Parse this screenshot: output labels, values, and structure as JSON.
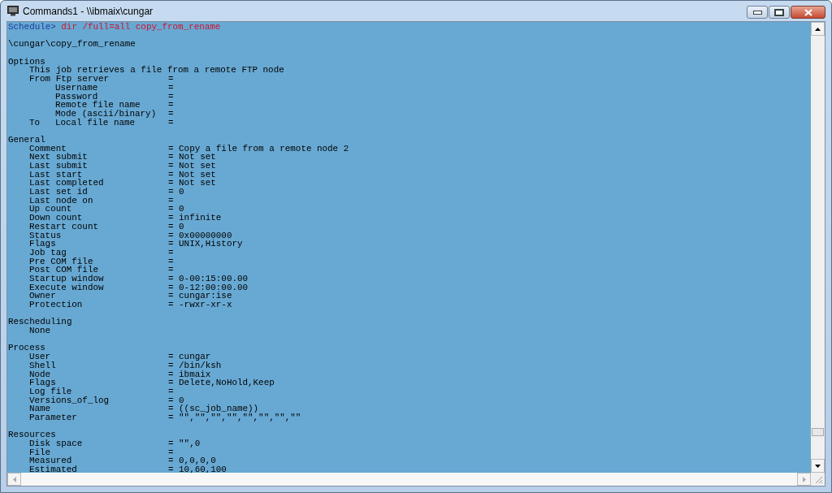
{
  "window": {
    "title": "Commands1 - \\\\ibmaix\\cungar"
  },
  "prompt": {
    "prefix": "Schedule>",
    "command": "dir /full=all copy_from_rename"
  },
  "path": "\\cungar\\copy_from_rename",
  "sections": [
    {
      "heading": "Options",
      "lines": [
        {
          "kind": "text",
          "label": "This job retrieves a file from a remote FTP node"
        },
        {
          "kind": "item",
          "label": "From Ftp server",
          "value": "="
        },
        {
          "kind": "sub",
          "label": "Username",
          "value": "="
        },
        {
          "kind": "sub",
          "label": "Password",
          "value": "="
        },
        {
          "kind": "sub",
          "label": "Remote file name",
          "value": "="
        },
        {
          "kind": "sub",
          "label": "Mode (ascii/binary)",
          "value": "="
        },
        {
          "kind": "prefixed",
          "prefix": "To",
          "label": "Local file name",
          "value": "="
        }
      ]
    },
    {
      "heading": "General",
      "lines": [
        {
          "kind": "item",
          "label": "Comment",
          "value": "= Copy a file from a remote node 2"
        },
        {
          "kind": "item",
          "label": "Next submit",
          "value": "= Not set"
        },
        {
          "kind": "item",
          "label": "Last submit",
          "value": "= Not set"
        },
        {
          "kind": "item",
          "label": "Last start",
          "value": "= Not set"
        },
        {
          "kind": "item",
          "label": "Last completed",
          "value": "= Not set"
        },
        {
          "kind": "item",
          "label": "Last set id",
          "value": "= 0"
        },
        {
          "kind": "item",
          "label": "Last node on",
          "value": "="
        },
        {
          "kind": "item",
          "label": "Up count",
          "value": "= 0"
        },
        {
          "kind": "item",
          "label": "Down count",
          "value": "= infinite"
        },
        {
          "kind": "item",
          "label": "Restart count",
          "value": "= 0"
        },
        {
          "kind": "item",
          "label": "Status",
          "value": "= 0x00000000"
        },
        {
          "kind": "item",
          "label": "Flags",
          "value": "= UNIX,History"
        },
        {
          "kind": "item",
          "label": "Job tag",
          "value": "="
        },
        {
          "kind": "item",
          "label": "Pre COM file",
          "value": "="
        },
        {
          "kind": "item",
          "label": "Post COM file",
          "value": "="
        },
        {
          "kind": "item",
          "label": "Startup window",
          "value": "= 0-00:15:00.00"
        },
        {
          "kind": "item",
          "label": "Execute window",
          "value": "= 0-12:00:00.00"
        },
        {
          "kind": "item",
          "label": "Owner",
          "value": "= cungar:ise"
        },
        {
          "kind": "item",
          "label": "Protection",
          "value": "= -rwxr-xr-x"
        }
      ]
    },
    {
      "heading": "Rescheduling",
      "lines": [
        {
          "kind": "text",
          "label": "None"
        }
      ]
    },
    {
      "heading": "Process",
      "lines": [
        {
          "kind": "item",
          "label": "User",
          "value": "= cungar"
        },
        {
          "kind": "item",
          "label": "Shell",
          "value": "= /bin/ksh"
        },
        {
          "kind": "item",
          "label": "Node",
          "value": "= ibmaix"
        },
        {
          "kind": "item",
          "label": "Flags",
          "value": "= Delete,NoHold,Keep"
        },
        {
          "kind": "item",
          "label": "Log file",
          "value": "="
        },
        {
          "kind": "item",
          "label": "Versions_of_log",
          "value": "= 0"
        },
        {
          "kind": "item",
          "label": "Name",
          "value": "= ((sc_job_name))"
        },
        {
          "kind": "item",
          "label": "Parameter",
          "value": "= \"\",\"\",\"\",\"\",\"\",\"\",\"\",\"\""
        }
      ]
    },
    {
      "heading": "Resources",
      "lines": [
        {
          "kind": "item",
          "label": "Disk space",
          "value": "= \"\",0"
        },
        {
          "kind": "item",
          "label": "File",
          "value": "="
        },
        {
          "kind": "item",
          "label": "Measured",
          "value": "= 0,0,0,0"
        },
        {
          "kind": "item",
          "label": "Estimated",
          "value": "= 10,60,100"
        }
      ]
    }
  ]
}
